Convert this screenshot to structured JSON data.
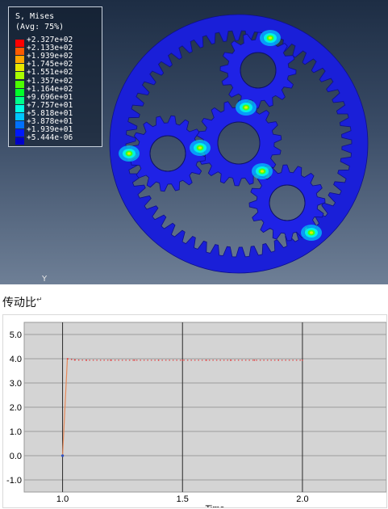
{
  "legend": {
    "title_line1": "S, Mises",
    "title_line2": "(Avg: 75%)",
    "values": [
      "+2.327e+02",
      "+2.133e+02",
      "+1.939e+02",
      "+1.745e+02",
      "+1.551e+02",
      "+1.357e+02",
      "+1.164e+02",
      "+9.696e+01",
      "+7.757e+01",
      "+5.818e+01",
      "+3.878e+01",
      "+1.939e+01",
      "+5.444e-06"
    ],
    "colors": [
      "#ff0000",
      "#ff5a00",
      "#ffa800",
      "#e8e800",
      "#a8ff00",
      "#4cff00",
      "#00ff29",
      "#00ff8a",
      "#00ffe4",
      "#00c6ff",
      "#0071ff",
      "#0019ff",
      "#0000c8"
    ]
  },
  "viewport": {
    "axis_label": "Y",
    "gear_color": "#1f22e6",
    "ring_color": "#1a1fd8"
  },
  "caption": {
    "text": "传动比",
    "mark": "↵"
  },
  "chart_data": {
    "type": "line",
    "title": "",
    "xlabel": "Time",
    "ylabel": "",
    "xlim": [
      0.84,
      2.35
    ],
    "ylim": [
      -1.5,
      5.5
    ],
    "xticks": [
      1.0,
      1.5,
      2.0
    ],
    "xtick_labels": [
      "1.0",
      "1.5",
      "2.0"
    ],
    "yticks": [
      -1.0,
      0.0,
      1.0,
      2.0,
      3.0,
      4.0,
      5.0
    ],
    "ytick_labels": [
      "-1.0",
      "0.0",
      "1.0",
      "2.0",
      "3.0",
      "4.0",
      "5.0"
    ],
    "grid": true,
    "series": [
      {
        "color": "#e03030",
        "x": [
          1.0,
          1.02,
          1.05,
          1.1,
          1.2,
          1.3,
          1.4,
          1.5,
          1.6,
          1.7,
          1.8,
          1.9,
          2.0
        ],
        "y": [
          0.0,
          4.0,
          3.95,
          3.94,
          3.94,
          3.94,
          3.94,
          3.94,
          3.94,
          3.94,
          3.94,
          3.94,
          3.94
        ]
      }
    ]
  }
}
